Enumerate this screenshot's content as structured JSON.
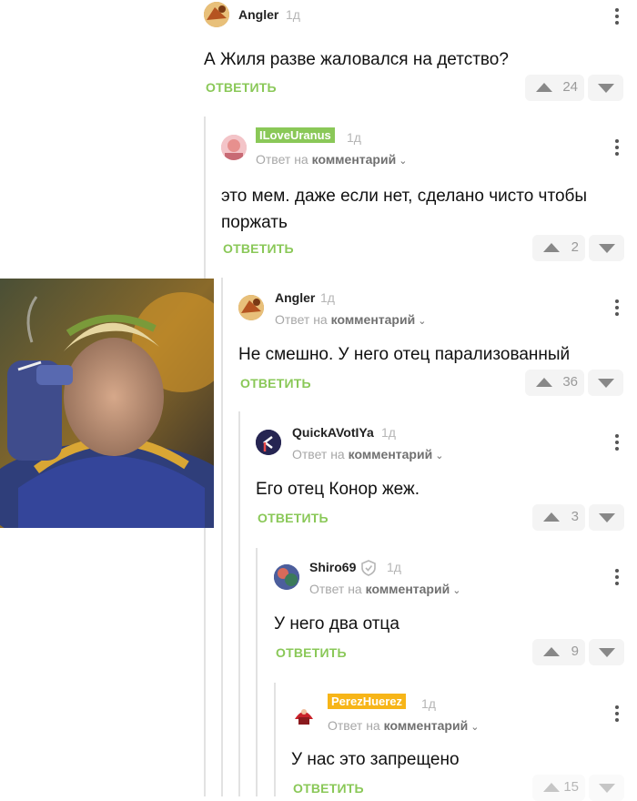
{
  "reply_label": "ОТВЕТИТЬ",
  "reply_to_prefix": "Ответ на",
  "reply_to_target": "комментарий",
  "comments": [
    {
      "user": "Angler",
      "age": "1д",
      "text": "А Жиля разве жаловался на детство?",
      "votes": "24"
    },
    {
      "user": "ILoveUranus",
      "age": "1д",
      "text": "это мем. даже если нет, сделано чисто чтобы поржать",
      "votes": "2",
      "badge_color": "#8ac858"
    },
    {
      "user": "Angler",
      "age": "1д",
      "text": "Не смешно. У него отец парализованный",
      "votes": "36"
    },
    {
      "user": "QuickAVotIYa",
      "age": "1д",
      "text": "Его отец Конор жеж.",
      "votes": "3"
    },
    {
      "user": "Shiro69",
      "age": "1д",
      "text": "У него два отца",
      "votes": "9"
    },
    {
      "user": "PerezHuerez",
      "age": "1д",
      "text": "У нас это запрещено",
      "votes": "15",
      "badge_color": "#f7b518"
    }
  ],
  "colors": {
    "accent_green": "#8ac858",
    "badge_yellow": "#f7b518"
  }
}
